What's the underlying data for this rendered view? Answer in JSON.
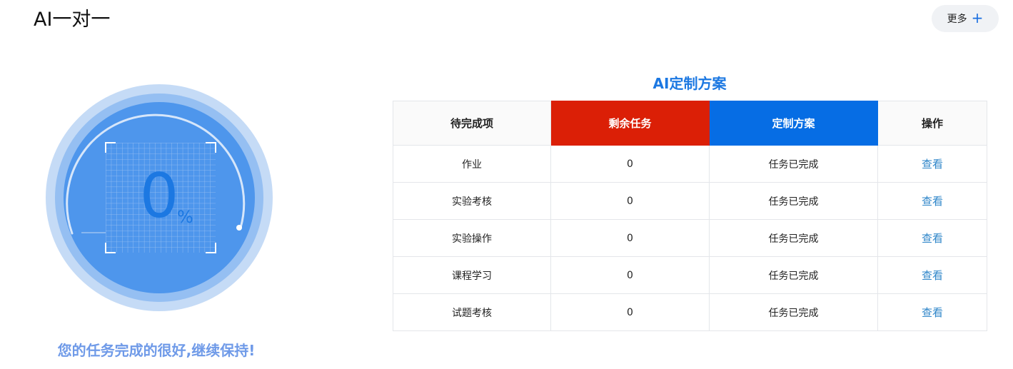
{
  "header": {
    "title": "AI一对一",
    "more_label": "更多"
  },
  "progress": {
    "value": "0",
    "unit": "%",
    "message": "您的任务完成的很好,继续保持!"
  },
  "plan": {
    "title": "AI定制方案",
    "columns": [
      "待完成项",
      "剩余任务",
      "定制方案",
      "操作"
    ],
    "rows": [
      {
        "item": "作业",
        "remaining": "0",
        "plan": "任务已完成",
        "action": "查看"
      },
      {
        "item": "实验考核",
        "remaining": "0",
        "plan": "任务已完成",
        "action": "查看"
      },
      {
        "item": "实验操作",
        "remaining": "0",
        "plan": "任务已完成",
        "action": "查看"
      },
      {
        "item": "课程学习",
        "remaining": "0",
        "plan": "任务已完成",
        "action": "查看"
      },
      {
        "item": "试题考核",
        "remaining": "0",
        "plan": "任务已完成",
        "action": "查看"
      }
    ]
  },
  "colors": {
    "accent_blue": "#066de4",
    "accent_red": "#db1f06",
    "link": "#2f86c9",
    "gauge_outer": "#c5dbf6",
    "gauge_mid": "#95bff2",
    "gauge_inner": "#4e96ec"
  }
}
